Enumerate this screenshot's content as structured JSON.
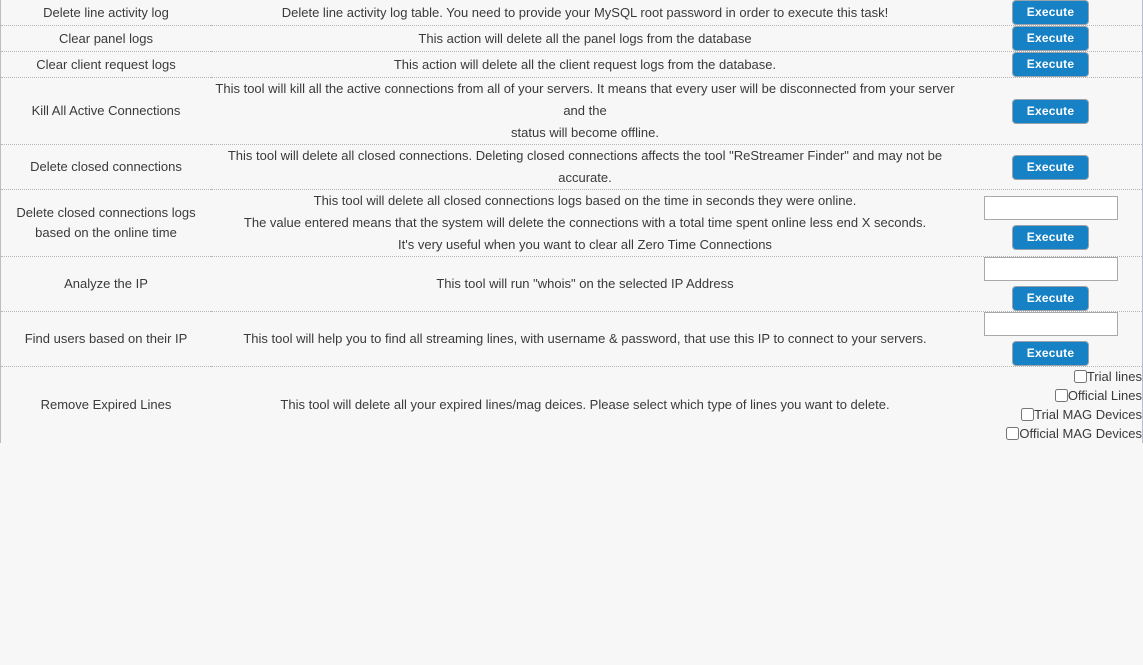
{
  "tools": [
    {
      "title": "Delete line activity log",
      "description_lines": [
        "Delete line activity log table. You need to provide your MySQL root password in order to execute this task!"
      ],
      "action": {
        "type": "button",
        "button_label": "Execute",
        "has_input": false
      }
    },
    {
      "title": "Clear panel logs",
      "description_lines": [
        "This action will delete all the panel logs from the database"
      ],
      "action": {
        "type": "button",
        "button_label": "Execute",
        "has_input": false
      }
    },
    {
      "title": "Clear client request logs",
      "description_lines": [
        "This action will delete all the client request logs from the database."
      ],
      "action": {
        "type": "button",
        "button_label": "Execute",
        "has_input": false
      }
    },
    {
      "title": "Kill All Active Connections",
      "description_lines": [
        "This tool will kill all the active connections from all of your servers. It means that every user will be disconnected from your server and the",
        "status will become offline."
      ],
      "action": {
        "type": "button",
        "button_label": "Execute",
        "has_input": false
      }
    },
    {
      "title": "Delete closed connections",
      "description_lines": [
        "This tool will delete all closed connections. Deleting closed connections affects the tool \"ReStreamer Finder\" and may not be accurate."
      ],
      "action": {
        "type": "button",
        "button_label": "Execute",
        "has_input": false
      }
    },
    {
      "title": "Delete closed connections logs based on the online time",
      "description_lines": [
        "This tool will delete all closed connections logs based on the time in seconds they were online.",
        "The value entered means that the system will delete the connections with a total time spent online less end X seconds.",
        "It's very useful when you want to clear all Zero Time Connections"
      ],
      "action": {
        "type": "input-button",
        "button_label": "Execute",
        "has_input": true,
        "input_value": "",
        "input_placeholder": ""
      }
    },
    {
      "title": "Analyze the IP",
      "description_lines": [
        "This tool will run \"whois\" on the selected IP Address"
      ],
      "action": {
        "type": "input-button",
        "button_label": "Execute",
        "has_input": true,
        "input_value": "",
        "input_placeholder": ""
      }
    },
    {
      "title": "Find users based on their IP",
      "description_lines": [
        "This tool will help you to find all streaming lines, with username & password, that use this IP to connect to your servers."
      ],
      "action": {
        "type": "input-button",
        "button_label": "Execute",
        "has_input": true,
        "input_value": "",
        "input_placeholder": ""
      }
    },
    {
      "title": "Remove Expired Lines",
      "description_lines": [
        "This tool will delete all your expired lines/mag deices. Please select which type of lines you want to delete."
      ],
      "action": {
        "type": "checkbox-group",
        "has_input": false,
        "checkboxes": [
          {
            "label": "Trial lines",
            "checked": false
          },
          {
            "label": "Official Lines",
            "checked": false
          },
          {
            "label": "Trial MAG Devices",
            "checked": false
          },
          {
            "label": "Official MAG Devices",
            "checked": false
          }
        ]
      }
    }
  ],
  "colors": {
    "page_background": "#f7f7f7",
    "button_blue": "#1682c5",
    "text": "#3a3a3a",
    "border": "#b8bfc6",
    "divider": "#b5b5b5"
  }
}
